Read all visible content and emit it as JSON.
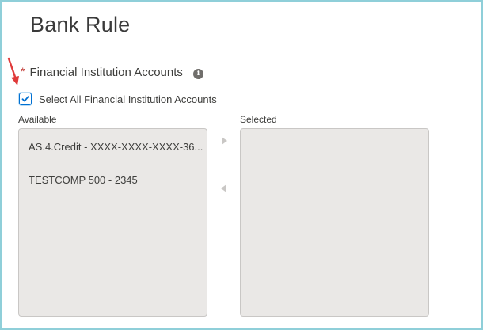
{
  "header": {
    "title": "Bank Rule"
  },
  "field": {
    "required_marker": "*",
    "label": "Financial Institution Accounts",
    "info_icon": "info-icon"
  },
  "select_all": {
    "checked": true,
    "label": "Select All Financial Institution Accounts"
  },
  "dual_list": {
    "available_label": "Available",
    "selected_label": "Selected",
    "available_items": [
      {
        "label": "AS.4.Credit - XXXX-XXXX-XXXX-36..."
      },
      {
        "label": "TESTCOMP 500 - 2345"
      }
    ],
    "selected_items": [],
    "move_right_icon": "triangle-right-icon",
    "move_left_icon": "triangle-left-icon"
  },
  "colors": {
    "frame_border": "#8fcfd9",
    "required": "#c23934",
    "checkbox_accent": "#0070d2",
    "listbox_bg": "#eae8e6",
    "annotation_arrow": "#e03a3a"
  }
}
